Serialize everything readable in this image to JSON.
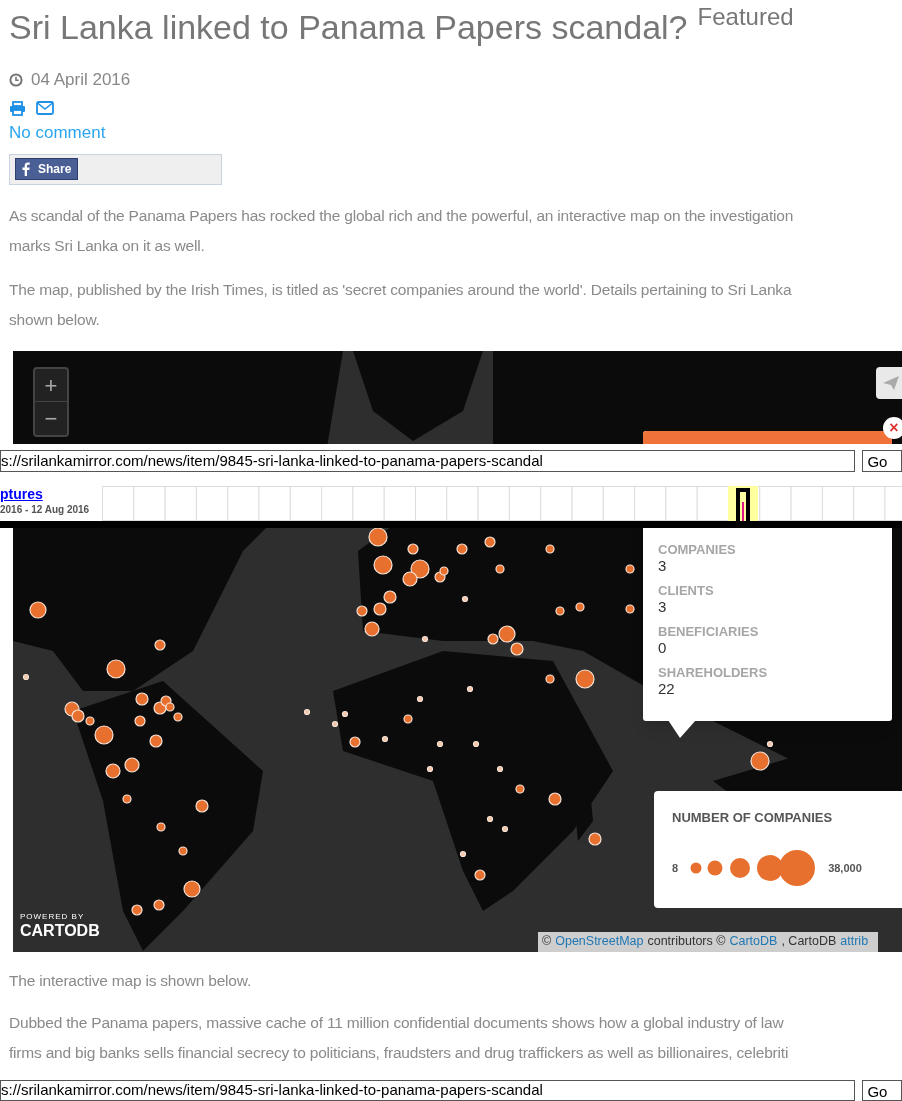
{
  "article": {
    "title": "Sri Lanka linked to Panama Papers scandal?",
    "badge": "Featured",
    "date": "04 April 2016",
    "comment_link": "No comment",
    "share_button": "Share",
    "paragraphs_before": [
      {
        "lines": [
          "As scandal of the Panama Papers has rocked the global rich and the powerful, an interactive map on the investigation",
          "marks Sri Lanka on it as well."
        ]
      },
      {
        "lines": [
          "The map, published by the Irish Times, is titled as 'secret companies around the world'. Details pertaining to Sri Lanka",
          "shown below."
        ]
      }
    ]
  },
  "map": {
    "zoom_in": "+",
    "zoom_out": "−",
    "close": "×",
    "popup": {
      "fields": [
        {
          "label": "COMPANIES",
          "value": "3"
        },
        {
          "label": "CLIENTS",
          "value": "3"
        },
        {
          "label": "BENEFICIARIES",
          "value": "0"
        },
        {
          "label": "SHAREHOLDERS",
          "value": "22"
        }
      ]
    },
    "legend": {
      "title": "NUMBER OF COMPANIES",
      "min": "8",
      "max": "38,000"
    },
    "logo": {
      "tagline": "POWERED BY",
      "name": "CARTODB"
    },
    "attribution": [
      {
        "kind": "text",
        "text": "©"
      },
      {
        "kind": "link",
        "text": "OpenStreetMap"
      },
      {
        "kind": "text",
        "text": "contributors ©"
      },
      {
        "kind": "link",
        "text": "CartoDB"
      },
      {
        "kind": "text",
        "text": ", CartoDB"
      },
      {
        "kind": "link",
        "text": "attrib"
      }
    ]
  },
  "wayback": {
    "url": "s://srilankamirror.com/news/item/9845-sri-lanka-linked-to-panama-papers-scandal",
    "go": "Go",
    "link": "ptures",
    "date_range": "2016 - 12 Aug 2016"
  },
  "paragraphs_after": [
    {
      "lines": [
        "The interactive map is shown below."
      ]
    },
    {
      "lines": [
        "Dubbed the Panama papers, massive cache of 11 million confidential documents shows how a global industry of law",
        "firms and big banks sells financial secrecy to politicians, fraudsters and drug traffickers as well as billionaires, celebriti"
      ]
    }
  ],
  "bottom_bar": {
    "url": "s://srilankamirror.com/news/item/9845-sri-lanka-linked-to-panama-papers-scandal",
    "go": "Go"
  }
}
